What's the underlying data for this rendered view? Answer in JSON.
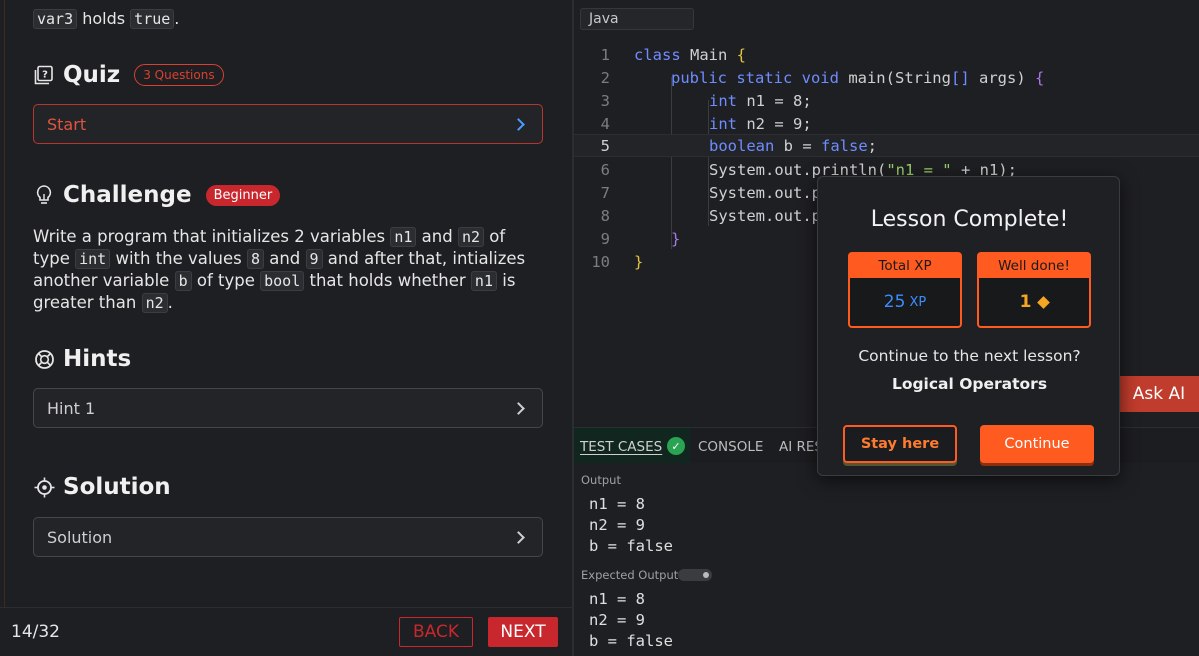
{
  "lesson": {
    "intro": {
      "var": "var3",
      "mid": " holds ",
      "val": "true",
      "end": "."
    },
    "quiz": {
      "title": "Quiz",
      "badge": "3 Questions",
      "start_label": "Start"
    },
    "challenge": {
      "title": "Challenge",
      "badge": "Beginner",
      "text": [
        "Write a program that initializes 2 variables ",
        "n1",
        " and ",
        "n2",
        " of type ",
        "int",
        " with the values ",
        "8",
        " and ",
        "9",
        " and after that, intializes another variable ",
        "b",
        " of type ",
        "bool",
        " that holds whether ",
        "n1",
        " is greater than ",
        "n2",
        "."
      ]
    },
    "hints": {
      "title": "Hints",
      "item": "Hint 1"
    },
    "solution": {
      "title": "Solution",
      "item": "Solution"
    },
    "footer": {
      "progress": "14/32",
      "back": "BACK",
      "next": "NEXT"
    }
  },
  "editor": {
    "language": "Java",
    "lines": [
      {
        "n": "1"
      },
      {
        "n": "2"
      },
      {
        "n": "3"
      },
      {
        "n": "4"
      },
      {
        "n": "5"
      },
      {
        "n": "6"
      },
      {
        "n": "7"
      },
      {
        "n": "8"
      },
      {
        "n": "9"
      },
      {
        "n": "10"
      }
    ],
    "code": {
      "l1": [
        "class",
        " Main ",
        "{"
      ],
      "l2": [
        "public static void",
        " main(",
        "String",
        "[]",
        " args) ",
        "{"
      ],
      "l3": [
        "int",
        " n1 = ",
        "8",
        ";"
      ],
      "l4": [
        "int",
        " n2 = ",
        "9",
        ";"
      ],
      "l5": [
        "boolean",
        " b = ",
        "false",
        ";"
      ],
      "l6": [
        "System.out.println(",
        "\"n1 = \"",
        " + n1);"
      ],
      "l7": [
        "System.out.p"
      ],
      "l8": [
        "System.out.p"
      ],
      "l9": [
        "}"
      ],
      "l10": [
        "}"
      ]
    },
    "ask_ai": "Ask AI"
  },
  "bottom_tabs": {
    "test_cases": "TEST CASES",
    "console": "CONSOLE",
    "ai_res": "AI RES",
    "output_label": "Output",
    "output": "n1 = 8\nn2 = 9\nb = false",
    "expected_label": "Expected Output",
    "expected": "n1 = 8\nn2 = 9\nb = false"
  },
  "modal": {
    "title": "Lesson Complete!",
    "xp_label": "Total XP",
    "xp_value": "25",
    "xp_unit": "XP",
    "done_label": "Well done!",
    "done_value": "1",
    "question": "Continue to the next lesson?",
    "next_lesson": "Logical Operators",
    "stay": "Stay here",
    "continue": "Continue"
  },
  "colors": {
    "accent": "#ff5a1f",
    "brand_red": "#c8282d",
    "success": "#2aa452"
  }
}
